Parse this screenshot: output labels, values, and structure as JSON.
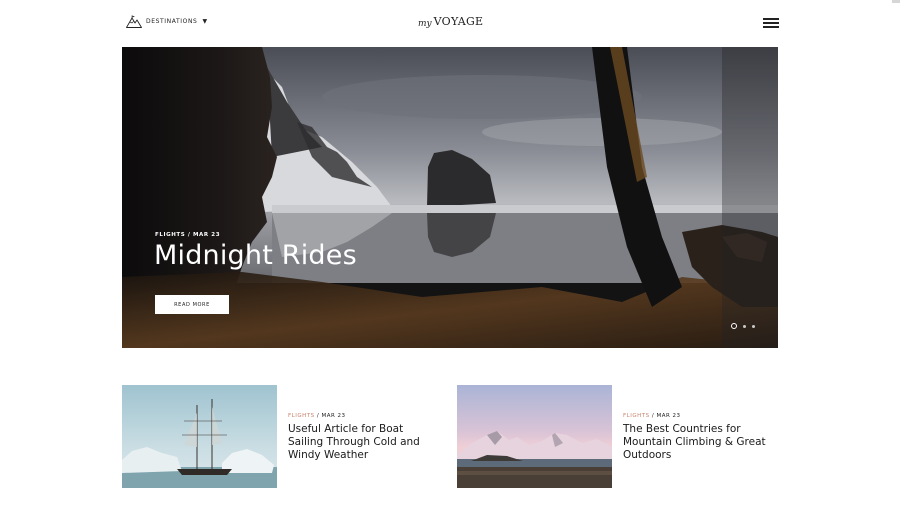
{
  "header": {
    "destinations_label": "DESTINATIONS",
    "logo_prefix": "my",
    "logo_name": "VOYAGE"
  },
  "hero": {
    "category": "FLIGHTS",
    "separator": "/",
    "date": "MAR 23",
    "title": "Midnight Rides",
    "button_label": "READ MORE",
    "slides_total": 3,
    "active_slide": 1
  },
  "posts": [
    {
      "category": "FLIGHTS",
      "separator": "/",
      "date": "MAR 23",
      "title": "Useful Article for Boat Sailing Through Cold and Windy Weather"
    },
    {
      "category": "FLIGHTS",
      "separator": "/",
      "date": "MAR 23",
      "title": "The Best Countries for Mountain Climbing & Great Outdoors"
    }
  ],
  "colors": {
    "accent": "#c9826b",
    "text": "#1a1a1a",
    "background": "#ffffff"
  },
  "icons": {
    "destinations": "mountain-icon",
    "menu": "hamburger-menu-icon"
  }
}
